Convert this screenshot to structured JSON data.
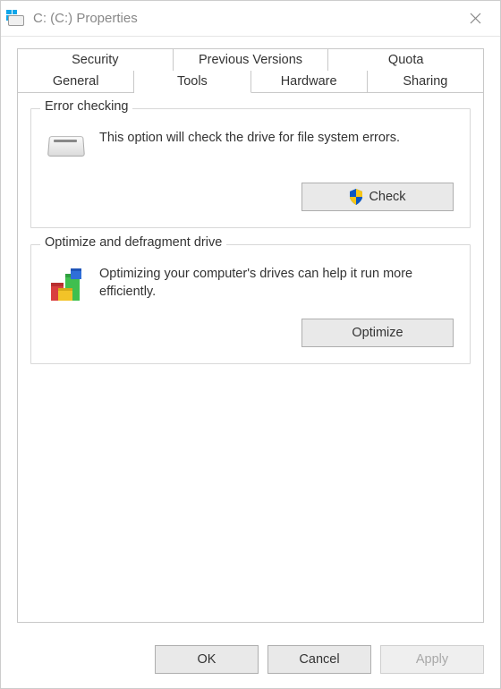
{
  "window": {
    "title": "C: (C:) Properties"
  },
  "tabs": {
    "row1": [
      "Security",
      "Previous Versions",
      "Quota"
    ],
    "row2": [
      "General",
      "Tools",
      "Hardware",
      "Sharing"
    ],
    "active": "Tools"
  },
  "error_checking": {
    "title": "Error checking",
    "description": "This option will check the drive for file system errors.",
    "button": "Check"
  },
  "optimize": {
    "title": "Optimize and defragment drive",
    "description": "Optimizing your computer's drives can help it run more efficiently.",
    "button": "Optimize"
  },
  "footer": {
    "ok": "OK",
    "cancel": "Cancel",
    "apply": "Apply"
  }
}
